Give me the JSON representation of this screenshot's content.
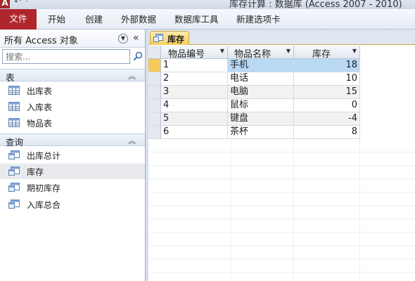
{
  "window": {
    "app_icon": "A",
    "quick_access": [
      "↶",
      "·"
    ],
    "title": "库存计算 : 数据库 (Access 2007 - 2010)"
  },
  "ribbon": {
    "file_tab": "文件",
    "tabs": [
      "开始",
      "创建",
      "外部数据",
      "数据库工具",
      "新建选项卡"
    ]
  },
  "nav": {
    "title": "所有 Access 对象",
    "dropdown_icon": "chevron-down-circle-icon",
    "collapse_icon": "double-chevron-left-icon",
    "search_placeholder": "搜索...",
    "groups": [
      {
        "label": "表",
        "items": [
          "出库表",
          "入库表",
          "物品表"
        ]
      },
      {
        "label": "查询",
        "items": [
          "出库总计",
          "库存",
          "期初库存",
          "入库总合"
        ]
      }
    ],
    "selected_item": "库存"
  },
  "document": {
    "tab_label": "库存",
    "columns": [
      "物品编号",
      "物品名称",
      "库存"
    ],
    "rows": [
      {
        "id": "1",
        "name": "手机",
        "stock": "18"
      },
      {
        "id": "2",
        "name": "电话",
        "stock": "10"
      },
      {
        "id": "3",
        "name": "电脑",
        "stock": "15"
      },
      {
        "id": "4",
        "name": "鼠标",
        "stock": "0"
      },
      {
        "id": "5",
        "name": "键盘",
        "stock": "-4"
      },
      {
        "id": "6",
        "name": "茶杯",
        "stock": "8"
      }
    ]
  },
  "colors": {
    "file_tab": "#b0262d",
    "doc_tab": "#f7cf5f",
    "current_row": "#b9d9f5"
  }
}
